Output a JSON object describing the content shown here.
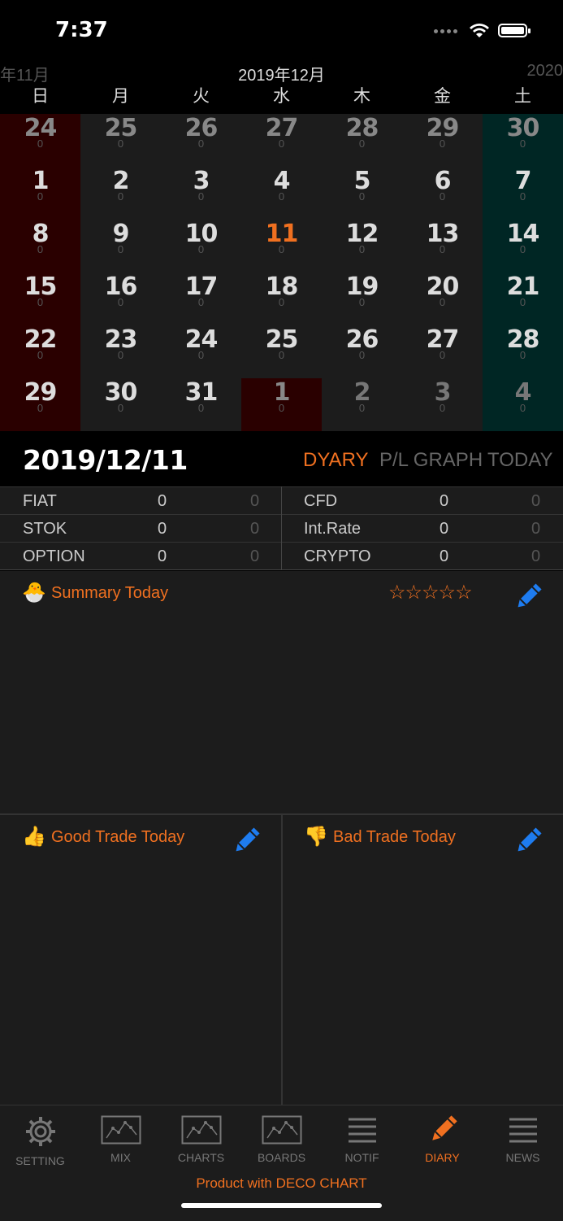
{
  "status": {
    "time": "7:37"
  },
  "calendar": {
    "prev_month": "年11月",
    "current_month": "2019年12月",
    "next_month": "2020",
    "weekdays": [
      "日",
      "月",
      "火",
      "水",
      "木",
      "金",
      "土"
    ],
    "weeks": [
      [
        {
          "d": "24",
          "v": "0"
        },
        {
          "d": "25",
          "v": "0"
        },
        {
          "d": "26",
          "v": "0"
        },
        {
          "d": "27",
          "v": "0"
        },
        {
          "d": "28",
          "v": "0"
        },
        {
          "d": "29",
          "v": "0"
        },
        {
          "d": "30",
          "v": "0"
        }
      ],
      [
        {
          "d": "1",
          "v": "0"
        },
        {
          "d": "2",
          "v": "0"
        },
        {
          "d": "3",
          "v": "0"
        },
        {
          "d": "4",
          "v": "0"
        },
        {
          "d": "5",
          "v": "0"
        },
        {
          "d": "6",
          "v": "0"
        },
        {
          "d": "7",
          "v": "0"
        }
      ],
      [
        {
          "d": "8",
          "v": "0"
        },
        {
          "d": "9",
          "v": "0"
        },
        {
          "d": "10",
          "v": "0"
        },
        {
          "d": "11",
          "v": "0"
        },
        {
          "d": "12",
          "v": "0"
        },
        {
          "d": "13",
          "v": "0"
        },
        {
          "d": "14",
          "v": "0"
        }
      ],
      [
        {
          "d": "15",
          "v": "0"
        },
        {
          "d": "16",
          "v": "0"
        },
        {
          "d": "17",
          "v": "0"
        },
        {
          "d": "18",
          "v": "0"
        },
        {
          "d": "19",
          "v": "0"
        },
        {
          "d": "20",
          "v": "0"
        },
        {
          "d": "21",
          "v": "0"
        }
      ],
      [
        {
          "d": "22",
          "v": "0"
        },
        {
          "d": "23",
          "v": "0"
        },
        {
          "d": "24",
          "v": "0"
        },
        {
          "d": "25",
          "v": "0"
        },
        {
          "d": "26",
          "v": "0"
        },
        {
          "d": "27",
          "v": "0"
        },
        {
          "d": "28",
          "v": "0"
        }
      ],
      [
        {
          "d": "29",
          "v": "0"
        },
        {
          "d": "30",
          "v": "0"
        },
        {
          "d": "31",
          "v": "0"
        },
        {
          "d": "1",
          "v": "0"
        },
        {
          "d": "2",
          "v": "0"
        },
        {
          "d": "3",
          "v": "0"
        },
        {
          "d": "4",
          "v": "0"
        }
      ]
    ]
  },
  "date_bar": {
    "selected_date": "2019/12/11",
    "tabs": [
      "DYARY",
      "P/L GRAPH",
      "TODAY"
    ],
    "active_tab": "DYARY"
  },
  "pl_table": {
    "left": [
      {
        "label": "FIAT",
        "value": "0",
        "sub": "0"
      },
      {
        "label": "STOK",
        "value": "0",
        "sub": "0"
      },
      {
        "label": "OPTION",
        "value": "0",
        "sub": "0"
      }
    ],
    "right": [
      {
        "label": "CFD",
        "value": "0",
        "sub": "0"
      },
      {
        "label": "Int.Rate",
        "value": "0",
        "sub": "0"
      },
      {
        "label": "CRYPTO",
        "value": "0",
        "sub": "0"
      }
    ]
  },
  "summary": {
    "emoji": "🐣",
    "title": "Summary Today",
    "stars": "☆☆☆☆☆"
  },
  "good_trade": {
    "emoji": "👍",
    "title": "Good Trade Today"
  },
  "bad_trade": {
    "emoji": "👎",
    "title": "Bad Trade Today"
  },
  "tabbar": {
    "items": [
      {
        "label": "SETTING",
        "icon": "gear-icon"
      },
      {
        "label": "MIX",
        "icon": "chart-icon"
      },
      {
        "label": "CHARTS",
        "icon": "chart-icon"
      },
      {
        "label": "BOARDS",
        "icon": "chart-icon"
      },
      {
        "label": "NOTIF",
        "icon": "list-icon"
      },
      {
        "label": "DIARY",
        "icon": "pencil-icon"
      },
      {
        "label": "NEWS",
        "icon": "list-icon"
      }
    ],
    "active": "DIARY",
    "product_text": "Product with DECO CHART"
  },
  "colors": {
    "accent": "#f07020",
    "sunday_bg": "#2a0000",
    "saturday_bg": "#002624",
    "edit_blue": "#1e7cf0"
  }
}
